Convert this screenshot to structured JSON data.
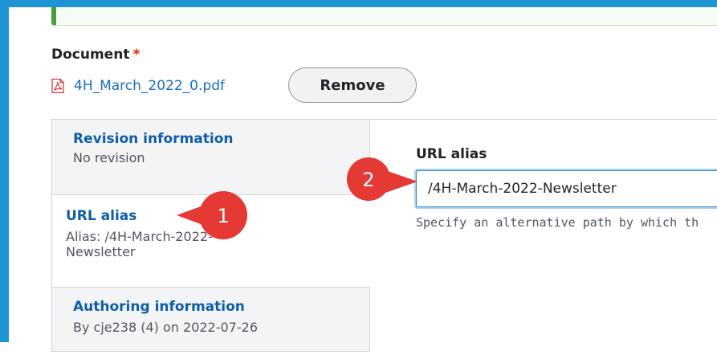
{
  "document": {
    "label": "Document",
    "required_marker": "*",
    "file_name": "4H_March_2022_0.pdf",
    "file_icon": "pdf-icon",
    "remove_label": "Remove"
  },
  "vertical_tabs": [
    {
      "title": "Revision information",
      "summary": "No revision",
      "active": false
    },
    {
      "title": "URL alias",
      "summary": "Alias: /4H-March-2022-Newsletter",
      "summary_line1": "Alias: /4H-March-2022-",
      "summary_line2": "Newsletter",
      "active": true
    },
    {
      "title": "Authoring information",
      "summary": "By cje238 (4) on 2022-07-26",
      "active": false
    }
  ],
  "url_alias": {
    "label": "URL alias",
    "value": "/4H-March-2022-Newsletter",
    "description": "Specify an alternative path by which th"
  },
  "callouts": [
    {
      "number": "1",
      "color": "#e53935"
    },
    {
      "number": "2",
      "color": "#e53935"
    }
  ],
  "colors": {
    "frame": "#1f94d4",
    "link": "#0f5ea8",
    "success_bar": "#42a03d",
    "required": "#e32700"
  }
}
